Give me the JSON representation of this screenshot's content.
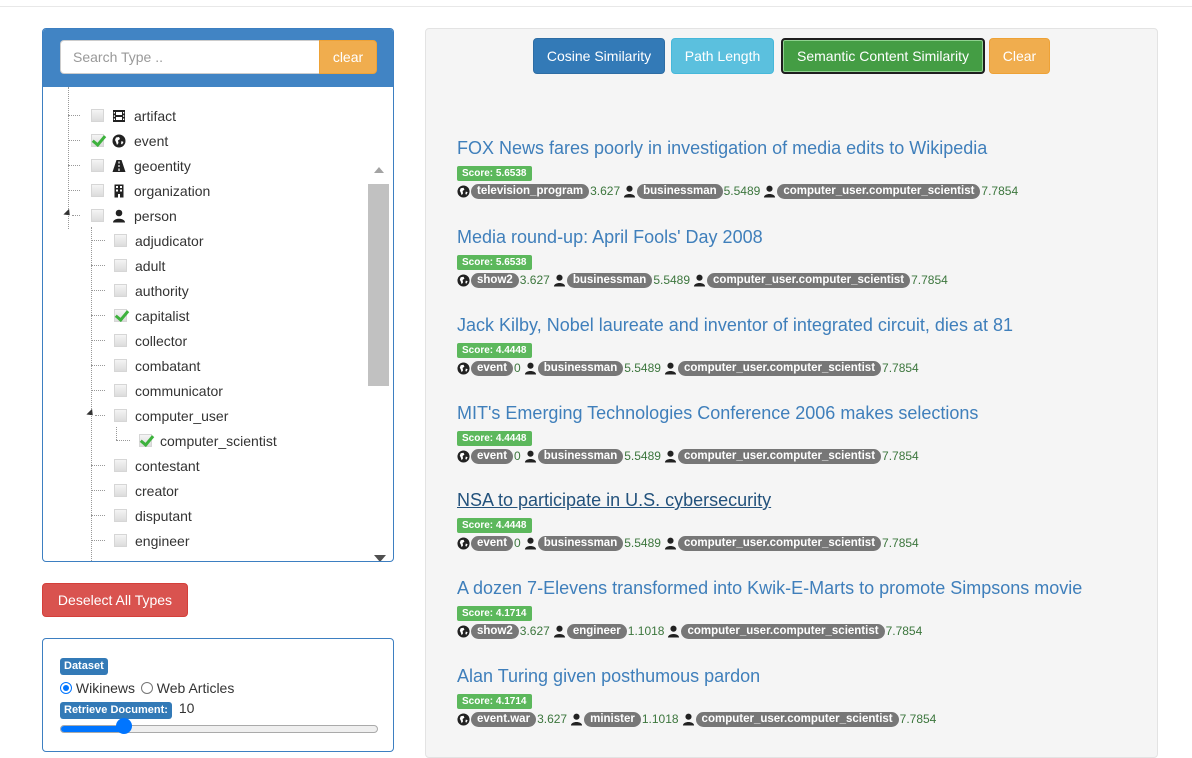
{
  "type_panel": {
    "search_placeholder": "Search Type ..",
    "clear_label": "clear",
    "tree": [
      {
        "label": "artifact",
        "checked": false,
        "icon": "film-icon"
      },
      {
        "label": "event",
        "checked": true,
        "icon": "globe-icon"
      },
      {
        "label": "geoentity",
        "checked": false,
        "icon": "road-icon"
      },
      {
        "label": "organization",
        "checked": false,
        "icon": "building-icon"
      },
      {
        "label": "person",
        "checked": false,
        "icon": "user-icon"
      },
      {
        "label": "adjudicator",
        "checked": false
      },
      {
        "label": "adult",
        "checked": false
      },
      {
        "label": "authority",
        "checked": false
      },
      {
        "label": "capitalist",
        "checked": true
      },
      {
        "label": "collector",
        "checked": false
      },
      {
        "label": "combatant",
        "checked": false
      },
      {
        "label": "communicator",
        "checked": false
      },
      {
        "label": "computer_user",
        "checked": false
      },
      {
        "label": "computer_scientist",
        "checked": true
      },
      {
        "label": "contestant",
        "checked": false
      },
      {
        "label": "creator",
        "checked": false
      },
      {
        "label": "disputant",
        "checked": false
      },
      {
        "label": "engineer",
        "checked": false
      }
    ]
  },
  "deselect_label": "Deselect All Types",
  "dataset": {
    "title": "Dataset",
    "options": [
      "Wikinews",
      "Web Articles"
    ],
    "selected": "Wikinews",
    "retrieve_label": "Retrieve Document:",
    "retrieve_value": "10",
    "retrieve_fraction": 0.2
  },
  "toolbar": {
    "cosine": "Cosine Similarity",
    "path": "Path Length",
    "semantic": "Semantic Content Similarity",
    "clear": "Clear"
  },
  "results": [
    {
      "title": "FOX News fares poorly in investigation of media edits to Wikipedia",
      "score": "Score: 5.6538",
      "e1": "television_program",
      "v1": "3.627",
      "e2": "businessman",
      "v2": "5.5489",
      "e3": "computer_user.computer_scientist",
      "v3": "7.7854"
    },
    {
      "title": "Media round-up: April Fools' Day 2008",
      "score": "Score: 5.6538",
      "e1": "show2",
      "v1": "3.627",
      "e2": "businessman",
      "v2": "5.5489",
      "e3": "computer_user.computer_scientist",
      "v3": "7.7854"
    },
    {
      "title": "Jack Kilby, Nobel laureate and inventor of integrated circuit, dies at 81",
      "score": "Score: 4.4448",
      "e1": "event",
      "v1": "0",
      "e2": "businessman",
      "v2": "5.5489",
      "e3": "computer_user.computer_scientist",
      "v3": "7.7854"
    },
    {
      "title": "MIT's Emerging Technologies Conference 2006 makes selections",
      "score": "Score: 4.4448",
      "e1": "event",
      "v1": "0",
      "e2": "businessman",
      "v2": "5.5489",
      "e3": "computer_user.computer_scientist",
      "v3": "7.7854"
    },
    {
      "title": "NSA to participate in U.S. cybersecurity",
      "score": "Score: 4.4448",
      "e1": "event",
      "v1": "0",
      "e2": "businessman",
      "v2": "5.5489",
      "e3": "computer_user.computer_scientist",
      "v3": "7.7854"
    },
    {
      "title": "A dozen 7-Elevens transformed into Kwik-E-Marts to promote Simpsons movie",
      "score": "Score: 4.1714",
      "e1": "show2",
      "v1": "3.627",
      "e2": "engineer",
      "v2": "1.1018",
      "e3": "computer_user.computer_scientist",
      "v3": "7.7854"
    },
    {
      "title": "Alan Turing given posthumous pardon",
      "score": "Score: 4.1714",
      "e1": "event.war",
      "v1": "3.627",
      "e2": "minister",
      "v2": "1.1018",
      "e3": "computer_user.computer_scientist",
      "v3": "7.7854"
    }
  ]
}
